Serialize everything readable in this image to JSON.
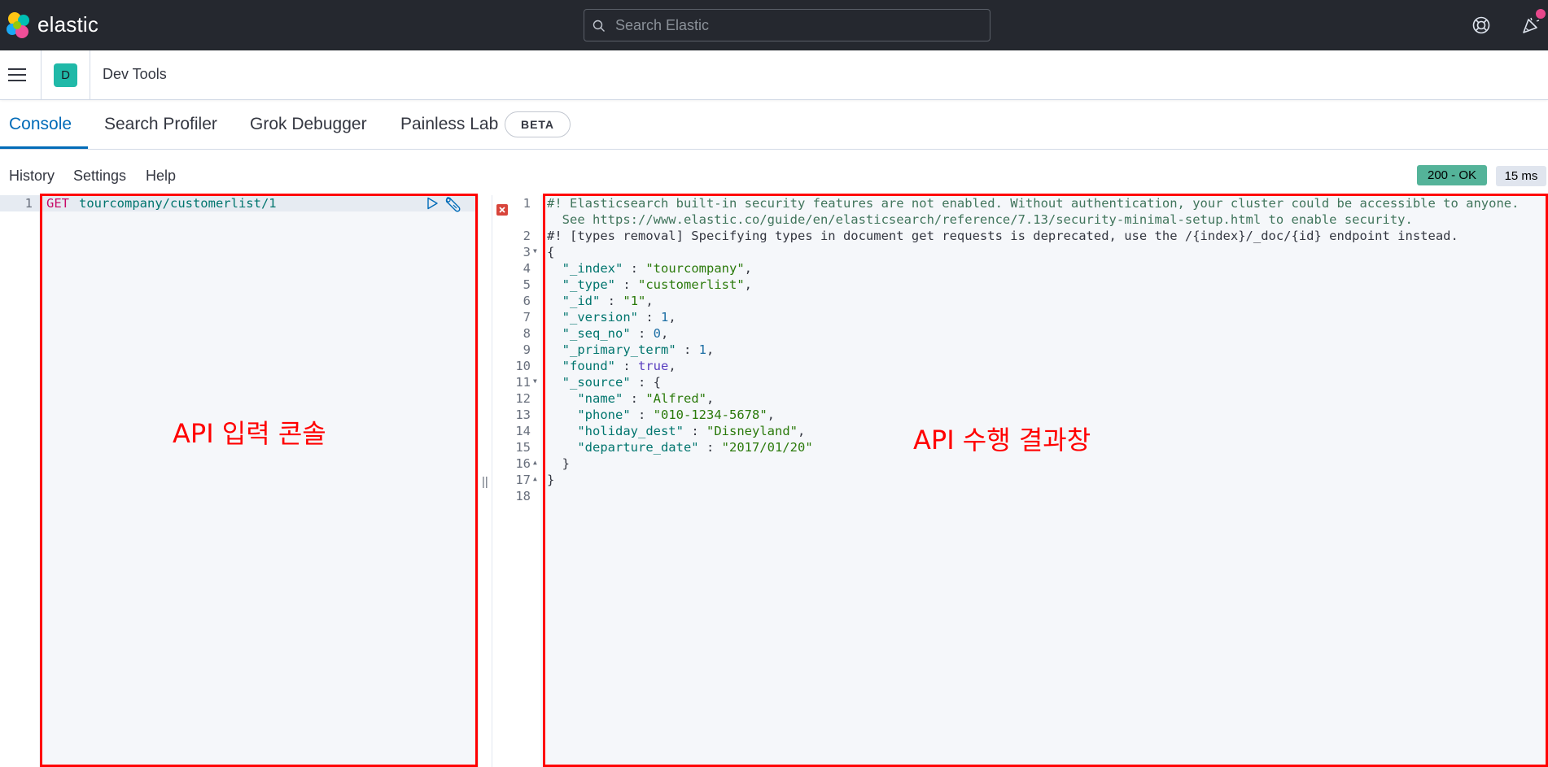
{
  "header": {
    "brand": "elastic",
    "search_placeholder": "Search Elastic",
    "icons": [
      "elastic-logo-icon",
      "search-icon",
      "help-icon",
      "newsfeed-icon"
    ]
  },
  "breadcrumb": {
    "space_initial": "D",
    "page_title": "Dev Tools"
  },
  "tabs": [
    {
      "label": "Console",
      "active": true
    },
    {
      "label": "Search Profiler",
      "active": false
    },
    {
      "label": "Grok Debugger",
      "active": false
    },
    {
      "label": "Painless Lab",
      "active": false
    }
  ],
  "beta_badge": "BETA",
  "toolbar": {
    "history": "History",
    "settings": "Settings",
    "help": "Help",
    "status": "200 - OK",
    "time": "15 ms"
  },
  "request": {
    "line_number": "1",
    "method": "GET",
    "path": "tourcompany/customerlist/1"
  },
  "response": {
    "line_numbers": [
      "1",
      "2",
      "3",
      "4",
      "5",
      "6",
      "7",
      "8",
      "9",
      "10",
      "11",
      "12",
      "13",
      "14",
      "15",
      "16",
      "17",
      "18"
    ],
    "warning_1a": "#! Elasticsearch built-in security features are not enabled. Without authentication, your cluster could be accessible to anyone.",
    "warning_1b": "  See https://www.elastic.co/guide/en/elasticsearch/reference/7.13/security-minimal-setup.html to enable security.",
    "warning_2": "#! [types removal] Specifying types in document get requests is deprecated, use the /{index}/_doc/{id} endpoint instead.",
    "doc": {
      "_index": "tourcompany",
      "_type": "customerlist",
      "_id": "1",
      "_version": "1",
      "_seq_no": "0",
      "_primary_term": "1",
      "found": "true",
      "source": {
        "name": "Alfred",
        "phone": "010-1234-5678",
        "holiday_dest": "Disneyland",
        "departure_date": "2017/01/20"
      }
    }
  },
  "annotations": {
    "left_label": "API 입력 콘솔",
    "right_label": "API 수행 결과창"
  },
  "colors": {
    "header_bg": "#25282f",
    "accent": "#006bb8",
    "status_ok": "#54b399",
    "annotation": "#ff0000"
  }
}
